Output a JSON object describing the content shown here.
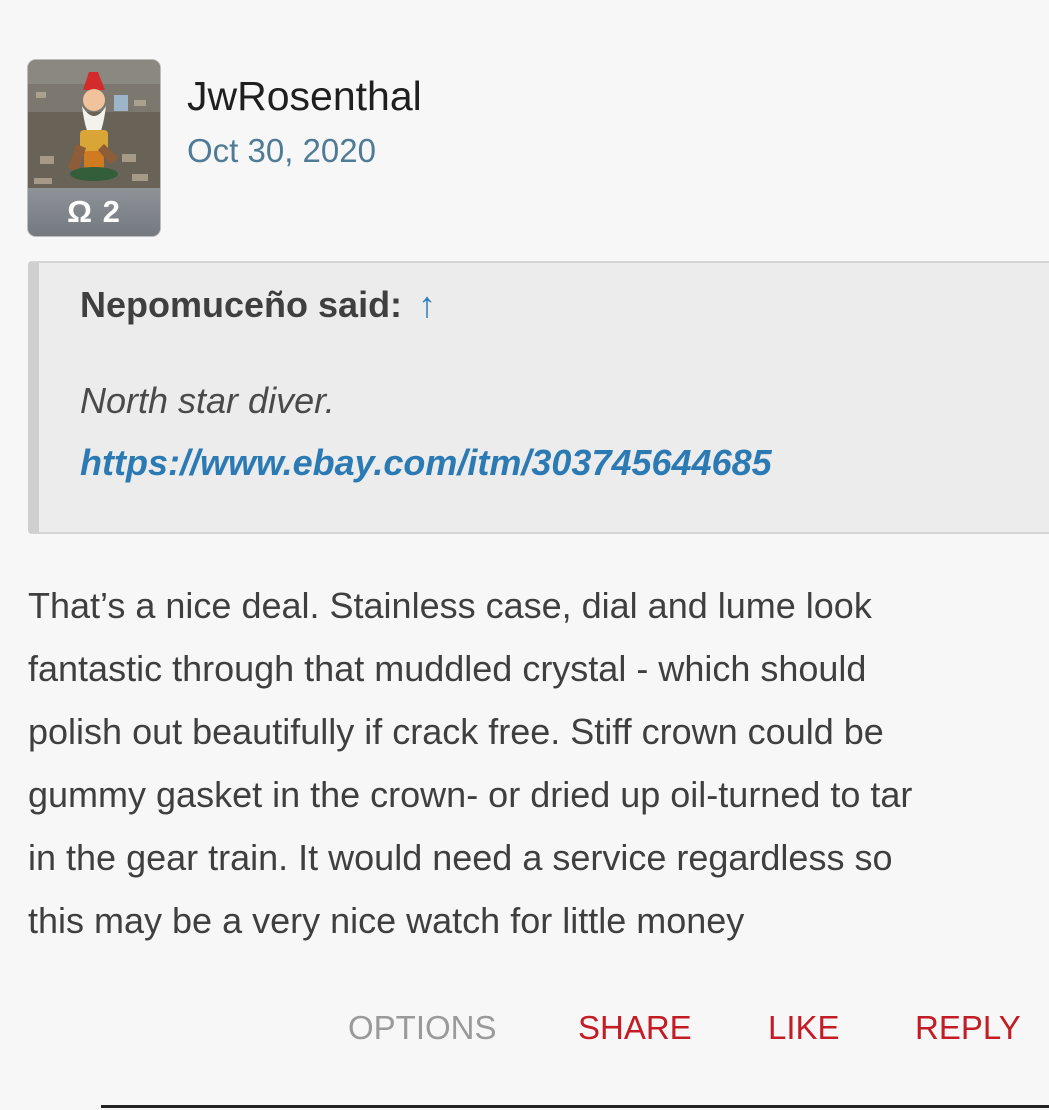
{
  "post": {
    "username": "JwRosenthal",
    "date": "Oct 30, 2020",
    "avatar_badge": "Ω 2",
    "quote": {
      "author_label": "Nepomuceño said:",
      "arrow": "↑",
      "text": "North star diver.",
      "link": "https://www.ebay.com/itm/303745644685"
    },
    "body_lines": [
      "That’s a nice deal. Stainless case, dial and lume look",
      "fantastic through that muddled crystal - which should",
      "polish out beautifully if crack free. Stiff crown could be",
      "gummy gasket in the crown- or dried up oil-turned to tar",
      "in the gear train. It would need a service regardless so",
      "this may be a very nice watch for little money"
    ],
    "actions": {
      "options": "OPTIONS",
      "share": "SHARE",
      "like": "LIKE",
      "reply": "REPLY"
    }
  },
  "colors": {
    "accent": "#c31c25",
    "link": "#2b7ab4",
    "date": "#4f7b97",
    "muted": "#9a9a9a"
  }
}
